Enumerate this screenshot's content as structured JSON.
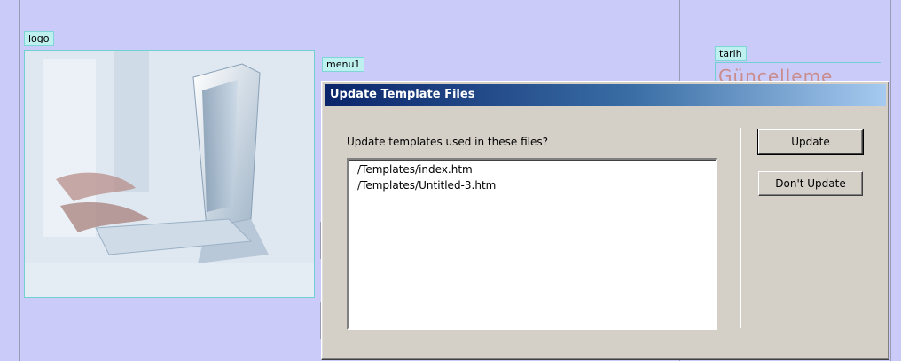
{
  "page": {
    "logo_label": "logo",
    "menu_label": "menu1",
    "date_label": "tarih",
    "date_text": "Güncelleme"
  },
  "dialog": {
    "title": "Update Template Files",
    "prompt": "Update templates used in these files?",
    "files": [
      "/Templates/index.htm",
      "/Templates/Untitled-3.htm"
    ],
    "update_label": "Update",
    "dont_update_label": "Don't Update"
  },
  "colors": {
    "canvas_bg": "#cbcbf9",
    "dialog_bg": "#d4d0c8",
    "titlebar_start": "#0a246a",
    "titlebar_end": "#a6caf0",
    "region_outline": "#6fd1d1"
  }
}
